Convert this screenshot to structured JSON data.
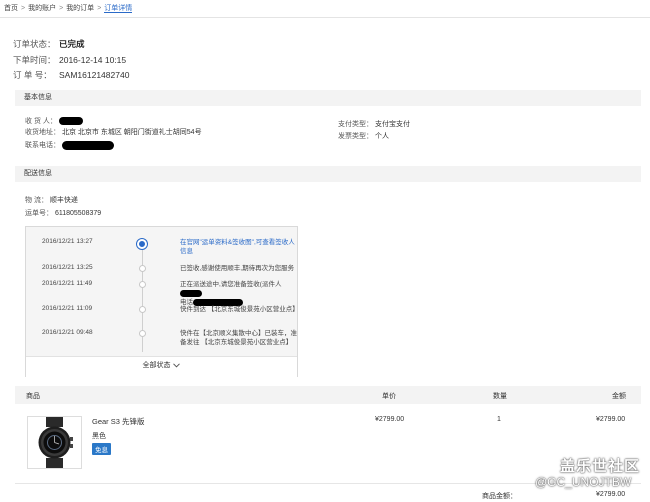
{
  "breadcrumb": {
    "items": [
      "首页",
      "我的账户",
      "我的订单"
    ],
    "current": "订单详情",
    "separator": ">"
  },
  "order_overview": {
    "status_label": "订单状态：",
    "status_value": "已完成",
    "time_label": "下单时间：",
    "time_value": "2016-12-14 10:15",
    "number_label": "订 单 号：",
    "number_value": "SAM16121482740"
  },
  "basic_info": {
    "title": "基本信息",
    "recipient_label": "收 货 人：",
    "address_label": "收货地址：",
    "address_value": "北京  北京市  东城区  朝阳门街道礼士胡同54号",
    "phone_label": "联系电话：",
    "payment_type_label": "支付类型：",
    "payment_type_value": "支付宝支付",
    "invoice_type_label": "发票类型：",
    "invoice_type_value": "个人"
  },
  "shipping_info": {
    "title": "配送信息",
    "carrier_label": "物    流：",
    "carrier_value": "顺丰快递",
    "waybill_label": "运单号：",
    "waybill_value": "611805508379",
    "tracking": [
      {
        "time": "2016/12/21 13:27",
        "message": "在官网\"运单资料&签收图\",可查看签收人信息",
        "active": true
      },
      {
        "time": "2016/12/21 13:25",
        "message": "已签收,感谢使用顺丰,期待再次为您服务",
        "active": false
      },
      {
        "time": "2016/12/21 11:49",
        "message": "正在派送途中,请您准备签收(派件人",
        "message2": "电话",
        "active": false
      },
      {
        "time": "2016/12/21 11:09",
        "message": "快件到达 【北京东城俊景苑小区营业点】",
        "active": false
      },
      {
        "time": "2016/12/21 09:48",
        "message": "快件在【北京顺义集散中心】已装车，准备发往 【北京东城俊景苑小区营业点】",
        "active": false
      }
    ],
    "show_all_label": "全部状态",
    "show_all_icon": "chevron-down-icon"
  },
  "products_table": {
    "headers": {
      "product": "商品",
      "unit_price": "单价",
      "quantity": "数量",
      "amount": "金额"
    },
    "rows": [
      {
        "name": "Gear S3 先锋版",
        "color": "黑色",
        "badge": "免息",
        "unit_price": "¥2799.00",
        "quantity": "1",
        "amount": "¥2799.00"
      }
    ]
  },
  "summary": {
    "goods_amount_label": "商品金额：",
    "goods_amount_value": "¥2799.00"
  },
  "watermark": {
    "line1": "盖乐世社区",
    "line2": "@GC_UNOJTBW"
  },
  "colors": {
    "link_blue": "#2a6ac8",
    "badge_blue": "#2a78c8",
    "section_bg": "#f3f3f3"
  }
}
